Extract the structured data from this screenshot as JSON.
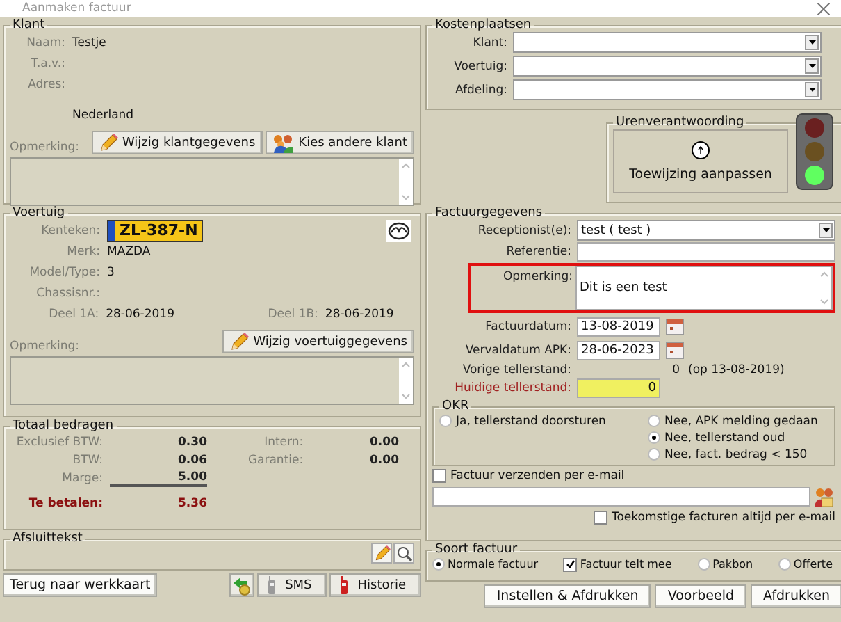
{
  "window": {
    "title": "Aanmaken factuur"
  },
  "klant": {
    "title": "Klant",
    "fields": [
      {
        "label": "Naam:",
        "value": "Testje"
      },
      {
        "label": "T.a.v.:"
      },
      {
        "label": "Adres:"
      }
    ],
    "country": "Nederland",
    "remark_label": "Opmerking:",
    "buttons": [
      {
        "label": "Wijzig klantgegevens",
        "kind": "edit"
      },
      {
        "label": "Kies andere klant",
        "kind": "choose"
      }
    ]
  },
  "voertuig": {
    "title": "Voertuig",
    "plate_label": "Kenteken:",
    "plate": "ZL-387-N",
    "fields": [
      {
        "label": "Merk:",
        "value": "MAZDA"
      },
      {
        "label": "Model/Type:",
        "value": "3"
      },
      {
        "label": "Chassisnr.:"
      }
    ],
    "deel": [
      {
        "label": "Deel 1A:",
        "value": "28-06-2019"
      },
      {
        "label": "Deel 1B:",
        "value": "28-06-2019"
      }
    ],
    "remark_label": "Opmerking:",
    "button": "Wijzig voertuiggegevens"
  },
  "totaal": {
    "title": "Totaal bedragen",
    "left": [
      {
        "label": "Exclusief BTW:",
        "value": "0.30"
      },
      {
        "label": "BTW:",
        "value": "0.06"
      },
      {
        "label": "Marge:",
        "value": "5.00"
      }
    ],
    "right": [
      {
        "label": "Intern:",
        "value": "0.00"
      },
      {
        "label": "Garantie:",
        "value": "0.00"
      }
    ],
    "total": {
      "label": "Te betalen:",
      "value": "5.36"
    }
  },
  "afsluittekst": {
    "title": "Afsluittekst"
  },
  "bottom_left": [
    {
      "kind": "text",
      "label": "Terug naar werkkaart"
    },
    {
      "kind": "icon"
    },
    {
      "kind": "sms",
      "label": "SMS"
    },
    {
      "kind": "history",
      "label": "Historie"
    }
  ],
  "kostenplaatsen": {
    "title": "Kostenplaatsen",
    "fields": [
      {
        "label": "Klant:"
      },
      {
        "label": "Voertuig:"
      },
      {
        "label": "Afdeling:"
      }
    ]
  },
  "urenverantwoording": {
    "title": "Urenverantwoording",
    "button": "Toewijzing aanpassen"
  },
  "factuurgegevens": {
    "title": "Factuurgegevens",
    "receptionist_label": "Receptionist(e):",
    "receptionist": "test ( test )",
    "referentie_label": "Referentie:",
    "remark": {
      "label": "Opmerking:",
      "value": "Dit is een test",
      "highlighted": true
    },
    "dates": [
      {
        "label": "Factuurdatum:",
        "value": "13-08-2019"
      },
      {
        "label": "Vervaldatum APK:",
        "value": "28-06-2023"
      }
    ],
    "vorige": {
      "label": "Vorige tellerstand:",
      "value": "0",
      "note": "(op 13-08-2019)"
    },
    "huidige": {
      "label": "Huidige tellerstand:",
      "value": "0"
    },
    "okr": {
      "title": "OKR",
      "options": [
        {
          "label": "Ja, tellerstand doorsturen",
          "selected": false
        },
        {
          "label": "Nee, APK melding gedaan",
          "selected": false
        },
        {
          "label": "Nee, tellerstand oud",
          "selected": true
        },
        {
          "label": "Nee, fact. bedrag < 150",
          "selected": false
        }
      ]
    },
    "email": {
      "label": "Factuur verzenden per e-mail",
      "checked": false,
      "future_label": "Toekomstige facturen altijd per e-mail",
      "future_checked": false
    }
  },
  "soort_factuur": {
    "title": "Soort factuur",
    "options": [
      {
        "kind": "radio",
        "label": "Normale factuur",
        "selected": true
      },
      {
        "kind": "checkbox",
        "label": "Factuur telt mee",
        "checked": true
      },
      {
        "kind": "radio",
        "label": "Pakbon",
        "selected": false
      },
      {
        "kind": "radio",
        "label": "Offerte",
        "selected": false
      }
    ]
  },
  "bottom_right": [
    "Instellen & Afdrukken",
    "Voorbeeld",
    "Afdrukken"
  ]
}
